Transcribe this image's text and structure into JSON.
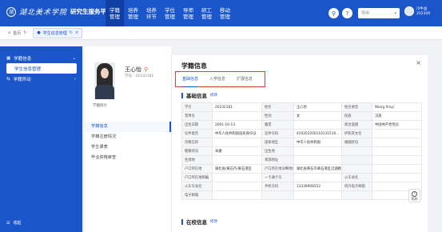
{
  "app": {
    "logo_mark": "湖",
    "logo_calligraphy": "湖北美术学院",
    "logo_subtitle": "研究生服务平台"
  },
  "nav": [
    {
      "line1": "学籍",
      "line2": "管理",
      "active": true
    },
    {
      "line1": "培养",
      "line2": "管理",
      "active": false
    },
    {
      "line1": "培养",
      "line2": "环节",
      "active": false
    },
    {
      "line1": "学位",
      "line2": "管理",
      "active": false
    },
    {
      "line1": "导师",
      "line2": "管理",
      "active": false
    },
    {
      "line1": "研工",
      "line2": "管理",
      "active": false
    },
    {
      "line1": "移动",
      "line2": "管理",
      "active": false
    }
  ],
  "header": {
    "search_icon": "search-icon",
    "help_icon": "help-icon",
    "role_select": "导师",
    "user_name": "冷牛益",
    "user_id": "202309"
  },
  "tabbar": {
    "home_label": "首页",
    "current_tab": "学生信息管理"
  },
  "sidebar": {
    "items": [
      {
        "label": "学籍信息",
        "icon": "grid-icon",
        "expanded": true
      },
      {
        "label": "学籍异动",
        "icon": "swap-icon",
        "expanded": false
      }
    ],
    "sub_item": "学生信息管理",
    "bottom_label": "收起"
  },
  "profile": {
    "name": "王心怡",
    "student_no_label": "学号：",
    "student_no": "20232181",
    "photo_caption": "学籍照片",
    "menu": [
      "学籍信息",
      "学籍注册情况",
      "学生课表",
      "毕业资格审查"
    ]
  },
  "panel": {
    "title": "学籍信息",
    "close": "×",
    "tabs": [
      "基础信息",
      "入学信息",
      "扩展信息"
    ],
    "section1_title": "基础信息",
    "section1_edit": "修改",
    "section2_title": "在校信息",
    "section2_edit": "修改",
    "rows": [
      [
        "学号",
        "20232181",
        "姓名",
        "王心怡",
        "姓名拼音",
        "Wang Xinyi"
      ],
      [
        "曾用名",
        "",
        "性别",
        "女",
        "民族",
        "汉族"
      ],
      [
        "出生日期",
        "2001-10-13",
        "籍贯",
        "",
        "政治面貌",
        "中国共产党党员"
      ],
      [
        "证件类型",
        "中华人民共和国居民身份证",
        "证件号码",
        "420202200110131516...",
        "护照英文名",
        ""
      ],
      [
        "宗教信仰",
        "",
        "国家地区",
        "中华人民共和国",
        "婚姻状况",
        ""
      ],
      [
        "健康状况",
        "未婚",
        "出生地",
        "",
        "",
        ""
      ],
      [
        "生源地",
        "",
        "来源地址",
        "",
        "",
        ""
      ],
      [
        "户口所在地",
        "湖北省/黄石市/黄石港区",
        "户口所在地详细地址",
        "湖北省黄石市黄石港区沿湖路学府小区1004",
        "",
        ""
      ],
      [
        "户口所在地邮编",
        "",
        "一卡通卡号",
        "",
        "火车站名",
        ""
      ],
      [
        "火车车站名",
        "",
        "手机号码",
        "13339908552",
        "校内电子邮箱",
        ""
      ],
      [
        "电子邮箱",
        "",
        "",
        "",
        "",
        ""
      ]
    ]
  },
  "help": {
    "label": "帮助",
    "glyph": "?"
  }
}
